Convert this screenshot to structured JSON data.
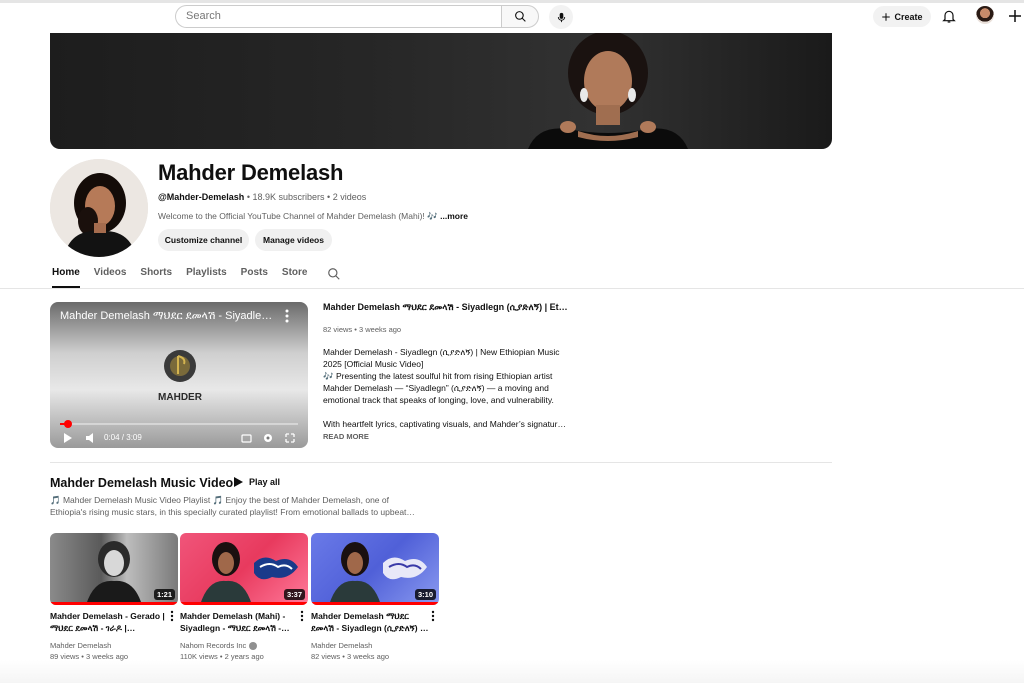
{
  "colors": {
    "accent": "#ff0000",
    "text": "#0f0f0f",
    "muted": "#606060",
    "pill_bg": "#f0f0f0"
  },
  "topbar": {
    "search_placeholder": "Search",
    "create_label": "Create",
    "icons": [
      "search-icon",
      "mic-icon",
      "plus-icon",
      "bell-icon",
      "avatar",
      "plus-icon"
    ]
  },
  "channel": {
    "name": "Mahder Demelash",
    "handle": "@Mahder-Demelash",
    "subscribers": "18.9K subscribers",
    "videos": "2 videos",
    "description": "Welcome to the Official YouTube Channel of Mahder Demelash (Mahi)! 🎶",
    "more": "...more",
    "customize_label": "Customize channel",
    "manage_label": "Manage videos"
  },
  "tabs": [
    {
      "label": "Home",
      "active": true
    },
    {
      "label": "Videos"
    },
    {
      "label": "Shorts"
    },
    {
      "label": "Playlists"
    },
    {
      "label": "Posts"
    },
    {
      "label": "Store"
    }
  ],
  "featured": {
    "player_title": "Mahder Demelash ማህደር ደመላሽ - Siyadle…",
    "time": "0:04 / 3:09",
    "progress": 0.02,
    "logo_text": "MAHDER",
    "title": "Mahder Demelash ማህደር ደመላሽ - Siyadlegn (ሲያድለኝ) | Ethiopi…",
    "meta": "82 views • 3 weeks ago",
    "description_lines": [
      "Mahder Demelash - Siyadlegn (ሲያድለኝ) | New Ethiopian Music",
      "2025 [Official Music Video]",
      "🎶 Presenting the latest soulful hit from rising Ethiopian artist",
      "Mahder Demelash — “Siyadlegn” (ሲያድለኝ) — a moving and",
      "emotional track that speaks of longing, love, and vulnerability.",
      "",
      "With heartfelt lyrics, captivating visuals, and Mahder’s signatur…"
    ],
    "read_more": "READ MORE"
  },
  "playlist": {
    "title": "Mahder Demelash Music Video",
    "play_all": "Play all",
    "description_lines": [
      "🎵 Mahder Demelash Music Video Playlist 🎵 Enjoy the best of Mahder Demelash, one of",
      "Ethiopia's rising music stars, in this specially curated playlist! From emotional ballads to upbeat…"
    ],
    "cards": [
      {
        "title_line1": "Mahder Demelash - Gerado |",
        "title_line2": "ማህደር ደመላሽ - ገራዶ |…",
        "duration": "1:21",
        "channel": "Mahder Demelash",
        "views": "89 views • 3 weeks ago",
        "verified": false
      },
      {
        "title_line1": "Mahder Demelash (Mahi) -",
        "title_line2": "Siyadlegn - ማህደር ደመላሽ -…",
        "duration": "3:37",
        "channel": "Nahom Records Inc",
        "views": "110K views • 2 years ago",
        "verified": true
      },
      {
        "title_line1": "Mahder Demelash ማህደር",
        "title_line2": "ደመላሽ - Siyadlegn (ሲያድለኝ) …",
        "duration": "3:10",
        "channel": "Mahder Demelash",
        "views": "82 views • 3 weeks ago",
        "verified": false
      }
    ]
  }
}
